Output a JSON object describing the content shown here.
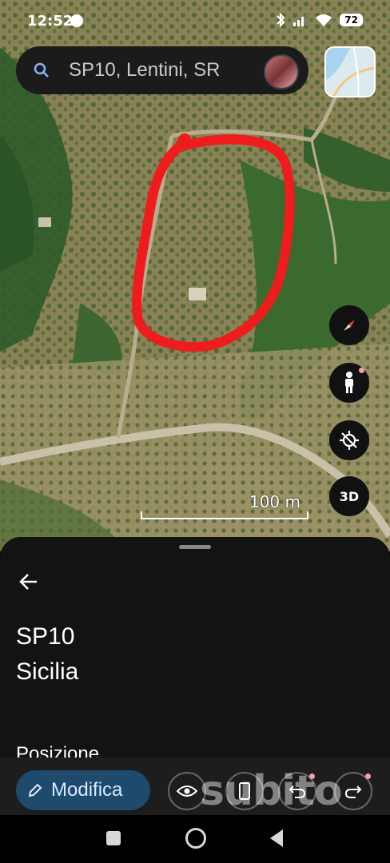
{
  "status_bar": {
    "time": "12:52",
    "battery": "72"
  },
  "search": {
    "text": "SP10, Lentini, SR"
  },
  "map": {
    "scale_label": "100 m",
    "button_3d": "3D",
    "highlight_color": "#ee1c1c"
  },
  "place": {
    "line1": "SP10",
    "line2": "Sicilia",
    "section_label": "Posizione"
  },
  "toolbar": {
    "edit_label": "Modifica"
  },
  "watermark": "subito"
}
